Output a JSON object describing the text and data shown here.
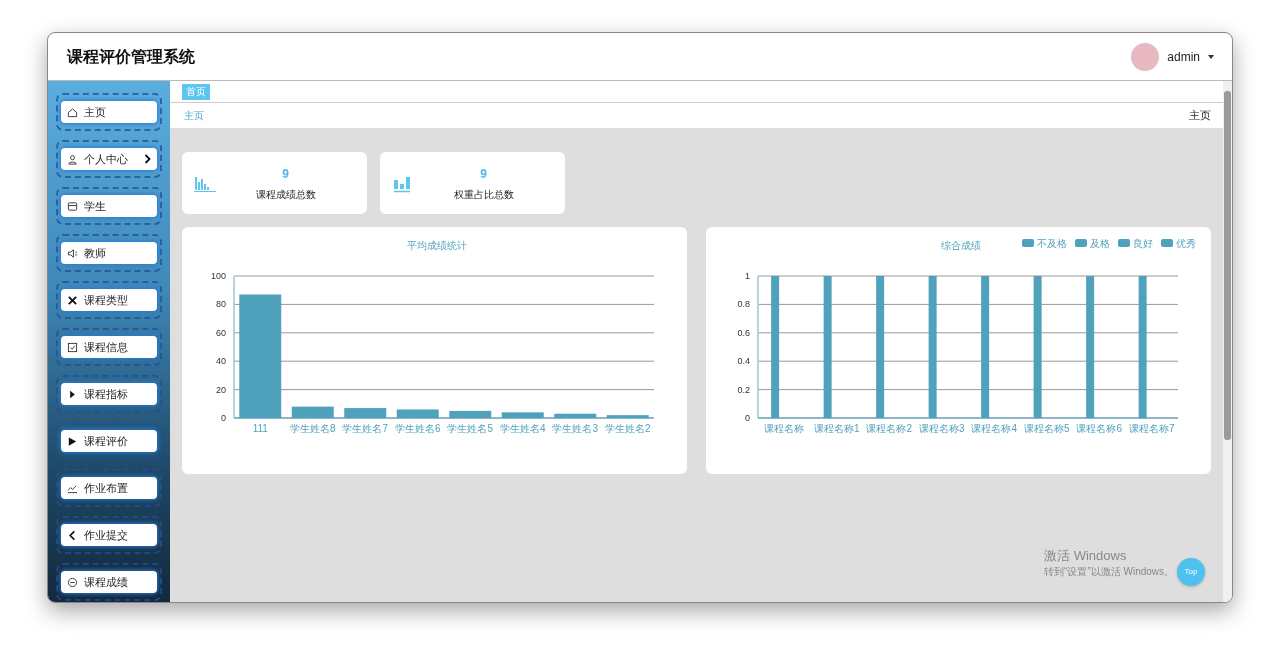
{
  "app": {
    "title": "课程评价管理系统"
  },
  "user": {
    "name": "admin"
  },
  "sidebar": {
    "items": [
      {
        "label": "主页",
        "expandable": false
      },
      {
        "label": "个人中心",
        "expandable": true
      },
      {
        "label": "学生",
        "expandable": false
      },
      {
        "label": "教师",
        "expandable": false
      },
      {
        "label": "课程类型",
        "expandable": false
      },
      {
        "label": "课程信息",
        "expandable": false
      },
      {
        "label": "课程指标",
        "expandable": false
      },
      {
        "label": "课程评价",
        "expandable": false
      },
      {
        "label": "作业布置",
        "expandable": false
      },
      {
        "label": "作业提交",
        "expandable": false
      },
      {
        "label": "课程成绩",
        "expandable": false
      }
    ]
  },
  "tabs": [
    {
      "label": "首页",
      "selected": true
    }
  ],
  "breadcrumb": {
    "label": "主页"
  },
  "page_title": "主页",
  "stats": [
    {
      "value": "9",
      "label": "课程成绩总数"
    },
    {
      "value": "9",
      "label": "权重占比总数"
    }
  ],
  "charts": [
    {
      "chart_data": {
        "type": "bar",
        "title": "平均成绩统计",
        "categories": [
          "111",
          "学生姓名8",
          "学生姓名7",
          "学生姓名6",
          "学生姓名5",
          "学生姓名4",
          "学生姓名3",
          "学生姓名2"
        ],
        "series": [
          {
            "color": "#4fa1bc",
            "values": [
              87,
              8,
              7,
              6,
              5,
              4,
              3,
              2
            ]
          }
        ],
        "ylim": [
          0,
          100
        ],
        "yticks": [
          0,
          20,
          40,
          60,
          80,
          100
        ],
        "grid": true
      }
    },
    {
      "chart_data": {
        "type": "bar",
        "title": "综合成绩",
        "categories": [
          "课程名称",
          "课程名称1",
          "课程名称2",
          "课程名称3",
          "课程名称4",
          "课程名称5",
          "课程名称6",
          "课程名称7"
        ],
        "series": [
          {
            "name": "不及格",
            "color": "#4fa1bc",
            "values": [
              1,
              1,
              1,
              1,
              1,
              1,
              1,
              1
            ]
          },
          {
            "name": "及格",
            "color": "#4fa1bc",
            "values": [
              0,
              0,
              0,
              0,
              0,
              0,
              0,
              0
            ]
          },
          {
            "name": "良好",
            "color": "#4fa1bc",
            "values": [
              0,
              0,
              0,
              0,
              0,
              0,
              0,
              0
            ]
          },
          {
            "name": "优秀",
            "color": "#4fa1bc",
            "values": [
              0,
              0,
              0,
              0,
              0,
              0,
              0,
              0
            ]
          }
        ],
        "ylim": [
          0,
          1
        ],
        "yticks": [
          {
            "value": 0,
            "label": "0"
          },
          {
            "value": 0.2,
            "label": "0.2"
          },
          {
            "value": 0.4,
            "label": "0.4"
          },
          {
            "value": 0.6,
            "label": "0.6"
          },
          {
            "value": 0.8,
            "label": "0.8"
          },
          {
            "value": 1,
            "label": "1"
          }
        ],
        "grid": true
      }
    }
  ],
  "windows_notice": {
    "title": "激活 Windows",
    "subtitle": "转到“设置”以激活 Windows。"
  },
  "back_to_top": {
    "label": "Top"
  }
}
